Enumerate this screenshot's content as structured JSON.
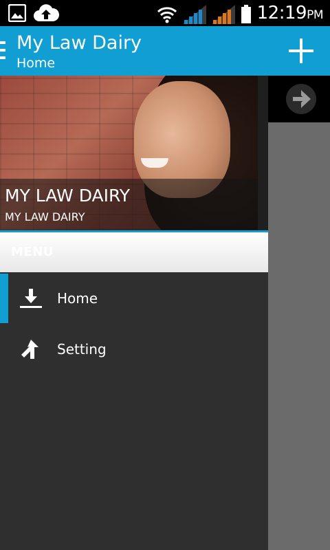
{
  "status_bar": {
    "time": "12:19",
    "ampm": "PM",
    "icons": [
      "image-icon",
      "cloud-upload-icon",
      "wifi-icon",
      "signal-icon",
      "signal-icon",
      "battery-icon"
    ]
  },
  "action_bar": {
    "title": "My Law Dairy",
    "subtitle": "Home",
    "add_icon": "plus-icon"
  },
  "drawer": {
    "hero": {
      "title": "MY LAW DAIRY",
      "subtitle": "MY LAW DAIRY"
    },
    "menu_header": "MENU",
    "items": [
      {
        "label": "Home",
        "icon": "download-icon",
        "selected": true
      },
      {
        "label": "Setting",
        "icon": "split-arrow-icon",
        "selected": false
      }
    ]
  },
  "main": {
    "next_icon": "arrow-right-icon"
  },
  "colors": {
    "accent": "#119ed2",
    "drawer_bg": "#2f2f2f",
    "status_bar": "#000000",
    "signal_1": "#1b8bd0",
    "signal_2": "#e0741a"
  }
}
